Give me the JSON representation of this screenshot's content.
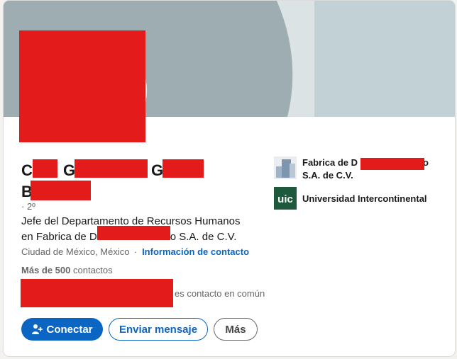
{
  "profile": {
    "name_parts": [
      "C",
      "G",
      "G",
      "B"
    ],
    "degree": "· 2º",
    "headline_line1": "Jefe del Departamento de Recursos Humanos",
    "headline_line2_prefix": "en Fabrica de D",
    "headline_line2_suffix": "o S.A. de C.V.",
    "location": "Ciudad de México, México",
    "separator": "·",
    "contact_info_link": "Información de contacto",
    "contacts_count": "Más de 500",
    "contacts_label": "contactos",
    "common_contacts_text": "es contacto en común"
  },
  "actions": {
    "connect_label": "Conectar",
    "message_label": "Enviar mensaje",
    "more_label": "Más"
  },
  "organizations": {
    "company_name_prefix": "Fabrica de D",
    "company_name_suffix": "o",
    "company_name_line2": "S.A. de C.V.",
    "school_name": "Universidad Intercontinental",
    "school_logo_text": "uic"
  },
  "colors": {
    "accent": "#0a66c2",
    "redaction": "#e31b1b",
    "banner": "#9eadb1",
    "school_logo_bg": "#1d5a3c"
  },
  "icons": {
    "connect": "add-person-icon"
  }
}
